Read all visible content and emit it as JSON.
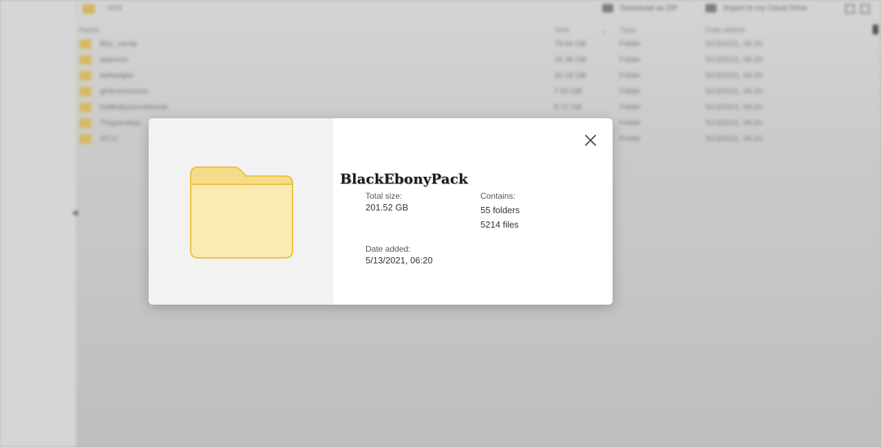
{
  "background": {
    "path_label": "XXX",
    "toolbar": {
      "download_zip": "Download as ZIP",
      "import_cloud": "Import to my Cloud Drive"
    },
    "columns": {
      "name": "Name",
      "size": "Size",
      "type": "Type",
      "date": "Date added"
    },
    "rows": [
      {
        "name": "Bby_candy",
        "size": "79.64 GB",
        "type": "Folder",
        "date": "5/13/2021, 06:20"
      },
      {
        "name": "iaiaonon",
        "size": "16.36 GB",
        "type": "Folder",
        "date": "5/13/2021, 06:20"
      },
      {
        "name": "bellaalgler",
        "size": "32.18 GB",
        "type": "Folder",
        "date": "5/13/2021, 06:20"
      },
      {
        "name": "girlsnextsouns",
        "size": "7.63 GB",
        "type": "Folder",
        "date": "5/13/2021, 06:20"
      },
      {
        "name": "badbabyazonblonde",
        "size": "8.72 GB",
        "type": "Folder",
        "date": "5/13/2021, 06:20"
      },
      {
        "name": "Thapocaliyp",
        "size": "",
        "type": "Folder",
        "date": "5/13/2021, 06:20"
      },
      {
        "name": "ATLC",
        "size": "",
        "type": "Folder",
        "date": "5/13/2021, 06:20"
      }
    ]
  },
  "modal": {
    "title": "BlackEbonyPack",
    "total_size_label": "Total size:",
    "total_size_value": "201.52 GB",
    "contains_label": "Contains:",
    "folders": "55 folders",
    "files": "5214 files",
    "date_added_label": "Date added:",
    "date_added_value": "5/13/2021, 06:20",
    "folder_icon": "folder-icon",
    "close_icon": "close-icon",
    "colors": {
      "folder_fill": "#fbeab2",
      "folder_stroke": "#e9c246",
      "folder_tab": "#f6dc8a"
    }
  }
}
